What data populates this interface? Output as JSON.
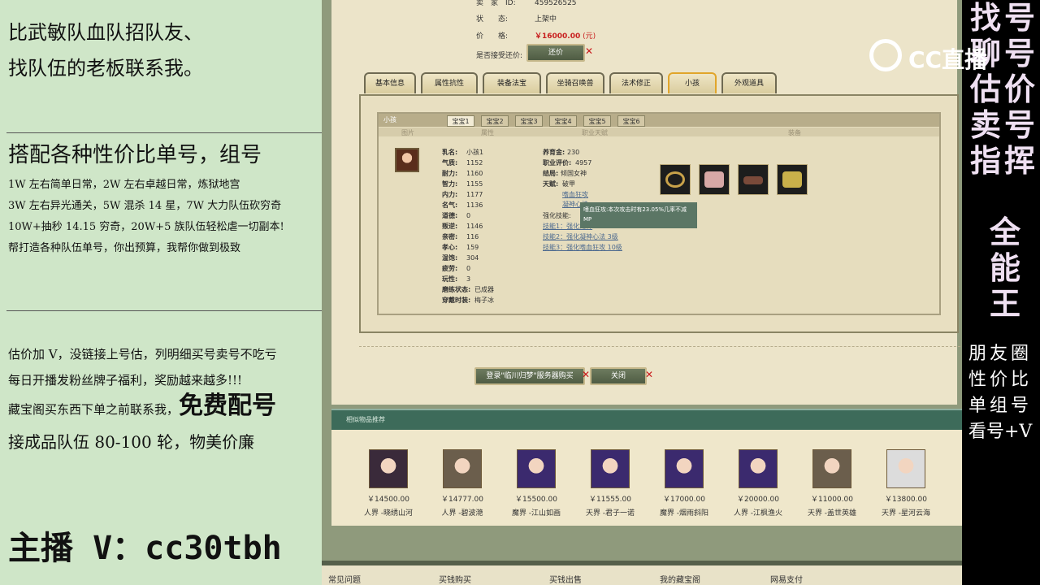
{
  "left": {
    "line1": "比武敏队血队招队友、",
    "line2": "找队伍的老板联系我。",
    "combo": "搭配各种性价比单号，组号",
    "small1": "1W 左右简单日常，2W 左右卓越日常，炼狱地宫",
    "small2": "3W 左右异光通关，5W 混杀 14 星，7W 大力队伍砍穷奇",
    "small3": "10W+抽秒 14.15 穷奇，20W+5 族队伍轻松虐一切副本!",
    "small4": "帮打造各种队伍单号，你出预算，我帮你做到极致",
    "est1": "估价加 V，没链接上号估，列明细买号卖号不吃亏",
    "est2": "每日开播发粉丝牌子福利，奖励越来越多!!!",
    "est3a": "藏宝阁买东西下单之前联系我，",
    "est3b": "免费配号",
    "lineup": "接成品队伍 80-100 轮，物美价廉",
    "host": "主播 V：cc30tbh"
  },
  "game": {
    "seller_label": "卖　家　ID:",
    "seller_value": "459526525",
    "status_label": "状　　态:",
    "status_value": "上架中",
    "price_label": "价　　格:",
    "price_value": "￥16000.00",
    "price_unit": "(元)",
    "bargain_label": "是否接受还价:",
    "bargain_button": "还价",
    "tabs": [
      "基本信息",
      "属性抗性",
      "装备法宝",
      "坐骑召唤兽",
      "法术修正",
      "小孩",
      "外观道具"
    ],
    "panel_title": "小孩",
    "subtabs": [
      "宝宝1",
      "宝宝2",
      "宝宝3",
      "宝宝4",
      "宝宝5",
      "宝宝6"
    ],
    "col_pic": "图片",
    "col_attr": "属性",
    "col_job": "职业天赋",
    "col_equip": "装备",
    "stats": [
      {
        "k": "乳名:",
        "v": "小孩1"
      },
      {
        "k": "气质:",
        "v": "1152"
      },
      {
        "k": "耐力:",
        "v": "1160"
      },
      {
        "k": "智力:",
        "v": "1155"
      },
      {
        "k": "内力:",
        "v": "1177"
      },
      {
        "k": "名气:",
        "v": "1136"
      },
      {
        "k": "道德:",
        "v": "0"
      },
      {
        "k": "叛逆:",
        "v": "1146"
      },
      {
        "k": "亲密:",
        "v": "116"
      },
      {
        "k": "孝心:",
        "v": "159"
      },
      {
        "k": "温饱:",
        "v": "304"
      },
      {
        "k": "疲劳:",
        "v": "0"
      },
      {
        "k": "玩性:",
        "v": "3"
      },
      {
        "k": "磨练状态:",
        "v": "已成器"
      },
      {
        "k": "穿戴时装:",
        "v": "梅子冰"
      }
    ],
    "job": [
      {
        "k": "养育金:",
        "v": "230"
      },
      {
        "k": "职业评价:",
        "v": "4957"
      },
      {
        "k": "结局:",
        "v": "倾国女神"
      },
      {
        "k": "天赋:",
        "v": "破甲"
      }
    ],
    "talent_links": [
      "嗜血狂攻",
      "凝神心法"
    ],
    "skills_label": "强化技能:",
    "skills": [
      "技能1：强化龙神",
      "技能2：强化凝神心法 3级",
      "技能3：强化嗜血狂攻 10级"
    ],
    "tooltip": "嗜血狂攻:本次攻击时有23.05%几率不减MP",
    "login_button": "登录\"临川归梦\"服务器购买",
    "close_button": "关闭",
    "similar_title": "相似物品推荐",
    "similar": [
      {
        "price": "￥14500.00",
        "name": "人界 -晓绣山河",
        "color": "#3a2a3a"
      },
      {
        "price": "￥14777.00",
        "name": "人界 -碧波滟",
        "color": "#6b5e4c"
      },
      {
        "price": "￥15500.00",
        "name": "魔界 -江山如画",
        "color": "#3b2a6e"
      },
      {
        "price": "￥11555.00",
        "name": "天界 -君子一诺",
        "color": "#3b2a6e"
      },
      {
        "price": "￥17000.00",
        "name": "魔界 -烟雨斜阳",
        "color": "#3b2a6e"
      },
      {
        "price": "￥20000.00",
        "name": "人界 -江枫渔火",
        "color": "#3b2a6e"
      },
      {
        "price": "￥11000.00",
        "name": "天界 -盖世英雄",
        "color": "#6b5e4c"
      },
      {
        "price": "￥13800.00",
        "name": "天界 -星河云海",
        "color": "#dcdcdc"
      }
    ],
    "footer": [
      "常见问题",
      "买钱购买",
      "买钱出售",
      "我的藏宝阁",
      "网易支付"
    ]
  },
  "right": {
    "col1": [
      "找",
      "聊",
      "估",
      "卖",
      "指"
    ],
    "col2": [
      "号",
      "号",
      "价",
      "号",
      "挥"
    ],
    "col3": [
      "全",
      "能",
      "王"
    ],
    "line1": "朋友圈",
    "line2": "性价比",
    "line3": "单组号",
    "line4": "看号+V"
  },
  "watermark": "CC直播"
}
